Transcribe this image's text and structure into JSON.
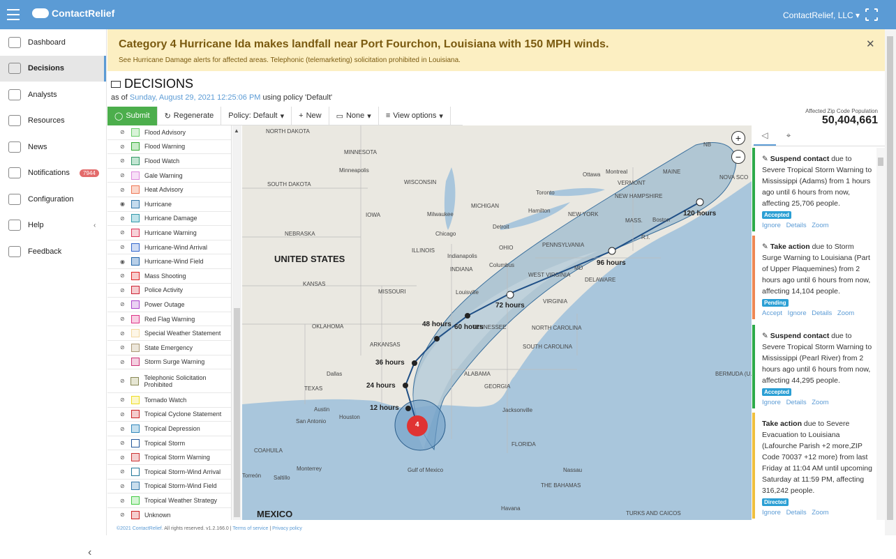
{
  "app": {
    "brand": "ContactRelief",
    "account": "ContactRelief, LLC"
  },
  "nav": [
    {
      "label": "Dashboard",
      "icon": "dashboard-icon"
    },
    {
      "label": "Decisions",
      "icon": "megaphone-icon",
      "active": true
    },
    {
      "label": "Analysts",
      "icon": "user-icon"
    },
    {
      "label": "Resources",
      "icon": "link-icon"
    },
    {
      "label": "News",
      "icon": "newspaper-icon"
    },
    {
      "label": "Notifications",
      "icon": "bell-icon",
      "badge": "7944"
    },
    {
      "label": "Configuration",
      "icon": "sliders-icon"
    },
    {
      "label": "Help",
      "icon": "help-icon"
    },
    {
      "label": "Feedback",
      "icon": "chat-icon"
    }
  ],
  "alert": {
    "title": "Category 4 Hurricane Ida makes landfall near Port Fourchon, Louisiana with 150 MPH winds.",
    "body": "See Hurricane Damage alerts for affected areas. Telephonic (telemarketing) solicitation prohibited in Louisiana."
  },
  "decisions": {
    "title": "DECISIONS",
    "asof_prefix": "as of",
    "asof_date": "Sunday, August 29, 2021 12:25:06 PM",
    "asof_suffix": "using policy 'Default'"
  },
  "toolbar": {
    "submit": "Submit",
    "regenerate": "Regenerate",
    "policy": "Policy: Default",
    "new": "New",
    "none": "None",
    "view": "View options"
  },
  "population": {
    "label": "Affected Zip Code Population",
    "value": "50,404,661"
  },
  "legend": [
    {
      "label": "Flood Advisory",
      "color": "#66cc66",
      "fill": "#d8f3d8"
    },
    {
      "label": "Flood Warning",
      "color": "#33aa33",
      "fill": "#c8ecc8"
    },
    {
      "label": "Flood Watch",
      "color": "#339966",
      "fill": "#c2e5d2"
    },
    {
      "label": "Gale Warning",
      "color": "#dd88dd",
      "fill": "#f7e0f7"
    },
    {
      "label": "Heat Advisory",
      "color": "#ee7755",
      "fill": "#fbd8cc"
    },
    {
      "label": "Hurricane",
      "color": "#3377aa",
      "fill": "#c4dbee"
    },
    {
      "label": "Hurricane Damage",
      "color": "#3399aa",
      "fill": "#bfe3ea"
    },
    {
      "label": "Hurricane Warning",
      "color": "#dd3355",
      "fill": "#f7d1d8"
    },
    {
      "label": "Hurricane-Wind Arrival",
      "color": "#3366cc",
      "fill": "#cfdcf4"
    },
    {
      "label": "Hurricane-Wind Field",
      "color": "#2266aa",
      "fill": "#b8cfe8"
    },
    {
      "label": "Mass Shooting",
      "color": "#dd2222",
      "fill": "#f8cccc"
    },
    {
      "label": "Police Activity",
      "color": "#cc2233",
      "fill": "#f5cccf"
    },
    {
      "label": "Power Outage",
      "color": "#aa44cc",
      "fill": "#ead3f3"
    },
    {
      "label": "Red Flag Warning",
      "color": "#dd3388",
      "fill": "#f8cfe3"
    },
    {
      "label": "Special Weather Statement",
      "color": "#f3d9a0",
      "fill": "#fdf6e6"
    },
    {
      "label": "State Emergency",
      "color": "#aa9977",
      "fill": "#ece6da"
    },
    {
      "label": "Storm Surge Warning",
      "color": "#cc3377",
      "fill": "#f4cfe0"
    },
    {
      "label": "Telephonic Solicitation Prohibited",
      "color": "#888855",
      "fill": "#e6e6d3",
      "tall": true
    },
    {
      "label": "Tornado Watch",
      "color": "#eedd22",
      "fill": "#fcf7c8"
    },
    {
      "label": "Tropical Cyclone Statement",
      "color": "#cc2222",
      "fill": "#f4cccc"
    },
    {
      "label": "Tropical Depression",
      "color": "#3388bb",
      "fill": "#c6e0ef"
    },
    {
      "label": "Tropical Storm",
      "color": "#225599",
      "fill": "#ffffff"
    },
    {
      "label": "Tropical Storm Warning",
      "color": "#cc3333",
      "fill": "#f4d0d0"
    },
    {
      "label": "Tropical Storm-Wind Arrival",
      "color": "#227799",
      "fill": "#ffffff"
    },
    {
      "label": "Tropical Storm-Wind Field",
      "color": "#3377aa",
      "fill": "#c9deed"
    },
    {
      "label": "Tropical Weather Strategy",
      "color": "#44cc44",
      "fill": "#d5f5d5"
    },
    {
      "label": "Unknown",
      "color": "#cc2222",
      "fill": "#f5cfcf"
    }
  ],
  "map": {
    "states": [
      "NORTH DAKOTA",
      "MINNESOTA",
      "SOUTH DAKOTA",
      "WISCONSIN",
      "MICHIGAN",
      "IOWA",
      "NEBRASKA",
      "ILLINOIS",
      "INDIANA",
      "OHIO",
      "PENNSYLVANIA",
      "NEW YORK",
      "KANSAS",
      "MISSOURI",
      "WEST VIRGINIA",
      "VIRGINIA",
      "OKLAHOMA",
      "ARKANSAS",
      "TENNESSEE",
      "NORTH CAROLINA",
      "SOUTH CAROLINA",
      "TEXAS",
      "ALABAMA",
      "GEORGIA",
      "FLORIDA",
      "VERMONT",
      "MAINE",
      "NEW HAMPSHIRE",
      "MASS.",
      "R.I.",
      "MD",
      "DELAWARE",
      "NOVA SCO",
      "COAHUILA",
      "Gulf of Mexico",
      "THE BAHAMAS",
      "BERMUDA (U.K.)",
      "TURKS AND CAICOS",
      "NB",
      "UNITED STATES",
      "MEXICO"
    ],
    "cities": [
      "Minneapolis",
      "Milwaukee",
      "Chicago",
      "Detroit",
      "Toronto",
      "Hamilton",
      "Ottawa",
      "Montreal",
      "Boston",
      "Indianapolis",
      "Columbus",
      "Louisville",
      "Dallas",
      "Austin",
      "San Antonio",
      "Houston",
      "Jacksonville",
      "Monterrey",
      "Saltillo",
      "Torreón",
      "Nassau",
      "Havana"
    ],
    "forecast": [
      "12 hours",
      "24 hours",
      "36 hours",
      "48 hours",
      "60 hours",
      "72 hours",
      "96 hours",
      "120 hours"
    ],
    "category": "4"
  },
  "cards": [
    {
      "action": "Suspend contact",
      "text": "due to Severe Tropical Storm Warning to Mississippi (Adams) from 1 hours ago until 6 hours from now, affecting 25,706 people.",
      "status": "Accepted",
      "links": "Ignore Details Zoom",
      "color": "#2eaa4a"
    },
    {
      "action": "Take action",
      "text": "due to Storm Surge Warning to Louisiana (Part of Upper Plaquemines) from 2 hours ago until 6 hours from now, affecting 14,104 people.",
      "status": "Pending",
      "links": "Accept Ignore Details Zoom",
      "color": "#ee8855"
    },
    {
      "action": "Suspend contact",
      "text": "due to Severe Tropical Storm Warning to Mississippi (Pearl River) from 2 hours ago until 6 hours from now, affecting 44,295 people.",
      "status": "Accepted",
      "links": "Ignore Details Zoom",
      "color": "#2eaa4a"
    },
    {
      "action": "Take action",
      "text": "due to Severe Evacuation to Louisiana (Lafourche Parish +2 more,ZIP Code 70037 +12 more) from last Friday at 11:04 AM until upcoming Saturday at 11:59 PM, affecting 316,242 people.",
      "status": "Directed",
      "links": "Ignore Details Zoom",
      "color": "#f0c040"
    }
  ],
  "footer": {
    "copy": "©2021",
    "brand": "ContactRelief.",
    "rights": "All rights reserved. v1.2.166.0 |",
    "terms": "Terms of service",
    "sep": "|",
    "privacy": "Privacy policy"
  }
}
